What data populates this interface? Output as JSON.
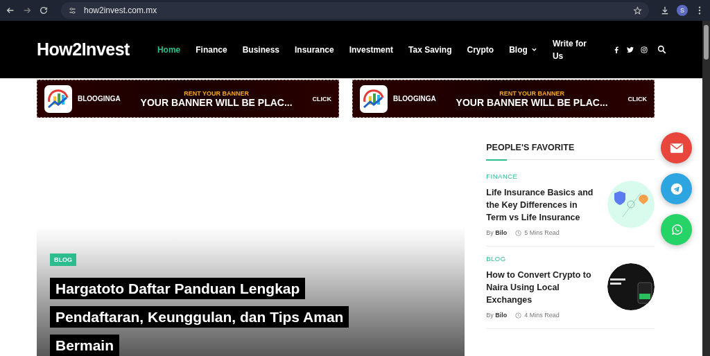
{
  "browser": {
    "url": "how2invest.com.mx",
    "profile_initial": "S"
  },
  "header": {
    "logo": "How2Invest",
    "nav": [
      {
        "label": "Home",
        "selected": true,
        "dropdown": false
      },
      {
        "label": "Finance",
        "selected": false,
        "dropdown": false
      },
      {
        "label": "Business",
        "selected": false,
        "dropdown": false
      },
      {
        "label": "Insurance",
        "selected": false,
        "dropdown": false
      },
      {
        "label": "Investment",
        "selected": false,
        "dropdown": false
      },
      {
        "label": "Tax Saving",
        "selected": false,
        "dropdown": false
      },
      {
        "label": "Crypto",
        "selected": false,
        "dropdown": false
      },
      {
        "label": "Blog",
        "selected": false,
        "dropdown": true
      },
      {
        "label": "Write for Us",
        "selected": false,
        "dropdown": false
      }
    ]
  },
  "banners": [
    {
      "brand": "BLOOGINGA",
      "kicker": "RENT YOUR BANNER",
      "headline": "YOUR BANNER WILL BE PLAC...",
      "action": "CLICK"
    },
    {
      "brand": "BLOOGINGA",
      "kicker": "RENT YOUR BANNER",
      "headline": "YOUR BANNER WILL BE PLAC...",
      "action": "CLICK"
    }
  ],
  "hero": {
    "category": "BLOG",
    "title": "Hargatoto Daftar Panduan Lengkap Pendaftaran, Keunggulan, dan Tips Aman Bermain"
  },
  "sidebar": {
    "heading": "PEOPLE'S FAVORITE",
    "posts": [
      {
        "category": "FINANCE",
        "title": "Life Insurance Basics and the Key Differences in Term vs Life Insurance",
        "by": "By",
        "author": "Bilo",
        "read_time": "5 Mins Read",
        "kind": "light"
      },
      {
        "category": "BLOG",
        "title": "How to Convert Crypto to Naira Using Local Exchanges",
        "by": "By",
        "author": "Bilo",
        "read_time": "4 Mins Read",
        "kind": "dark"
      }
    ]
  },
  "floating_buttons": [
    {
      "kind": "email",
      "color": "#e8453c"
    },
    {
      "kind": "telegram",
      "color": "#2ca5e0"
    },
    {
      "kind": "whatsapp",
      "color": "#25d366"
    }
  ]
}
